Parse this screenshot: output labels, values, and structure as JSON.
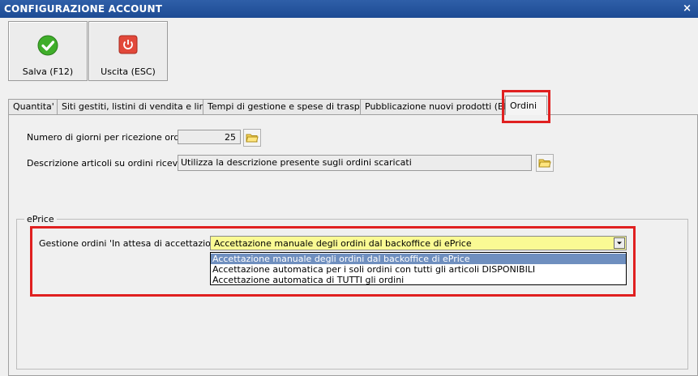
{
  "window": {
    "title": "CONFIGURAZIONE ACCOUNT",
    "close_label": "×"
  },
  "toolbar": {
    "save_label": "Salva (F12)",
    "exit_label": "Uscita (ESC)"
  },
  "tabs": [
    {
      "label": "Quantita'"
    },
    {
      "label": "Siti gestiti, listini di vendita e lingue"
    },
    {
      "label": "Tempi di gestione e spese di trasporto"
    },
    {
      "label": "Pubblicazione nuovi prodotti (BETA)"
    },
    {
      "label": "Ordini",
      "active": true
    }
  ],
  "orders": {
    "days_label": "Numero di giorni per ricezione ordini :",
    "days_value": "25",
    "description_label": "Descrizione articoli  su ordini ricevuti :",
    "description_value": "Utilizza la descrizione presente sugli ordini scaricati"
  },
  "eprice": {
    "group_title": "ePrice",
    "pending_label": "Gestione ordini 'In attesa di accettazione' :",
    "selected": "Accettazione manuale degli ordini dal backoffice di ePrice",
    "options": [
      "Accettazione manuale degli ordini dal backoffice di ePrice",
      "Accettazione automatica per i soli ordini con tutti gli articoli DISPONIBILI",
      "Accettazione automatica di TUTTI gli ordini"
    ]
  },
  "colors": {
    "titlebar": "#1d4b94",
    "highlight": "#e02020",
    "combo_bg": "#fafa94",
    "selected_option": "#6f8fbf"
  }
}
